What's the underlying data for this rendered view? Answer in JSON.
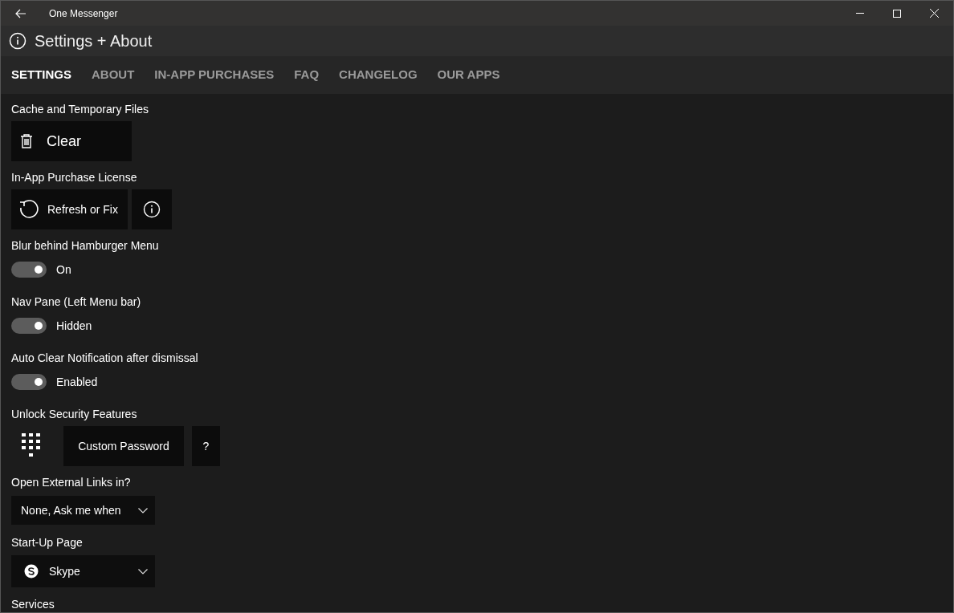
{
  "window": {
    "title": "One Messenger"
  },
  "page_title": "Settings + About",
  "tabs": [
    {
      "label": "SETTINGS",
      "selected": true
    },
    {
      "label": "ABOUT",
      "selected": false
    },
    {
      "label": "IN-APP PURCHASES",
      "selected": false
    },
    {
      "label": "FAQ",
      "selected": false
    },
    {
      "label": "CHANGELOG",
      "selected": false
    },
    {
      "label": "OUR APPS",
      "selected": false
    }
  ],
  "sections": [
    {
      "label": "Cache and Temporary Files",
      "kind": "buttons",
      "buttons": [
        {
          "kind": "trash",
          "label": "Clear"
        }
      ]
    },
    {
      "label": "In-App Purchase License",
      "kind": "buttons",
      "buttons": [
        {
          "kind": "refresh",
          "label": "Refresh or Fix"
        },
        {
          "kind": "info"
        }
      ]
    },
    {
      "label": "Blur behind Hamburger Menu",
      "kind": "toggle",
      "on": true,
      "state_text": "On"
    },
    {
      "label": "Nav Pane (Left Menu bar)",
      "kind": "toggle",
      "on": true,
      "state_text": "Hidden"
    },
    {
      "label": "Auto Clear Notification after dismissal",
      "kind": "toggle",
      "on": true,
      "state_text": "Enabled"
    },
    {
      "label": "Unlock Security Features",
      "kind": "buttons",
      "buttons": [
        {
          "kind": "keypad"
        },
        {
          "kind": "text",
          "label": "Custom Password"
        },
        {
          "kind": "text",
          "label": "?"
        }
      ]
    },
    {
      "label": "Open External Links in?",
      "kind": "dropdown",
      "value": "None, Ask me when"
    },
    {
      "label": "Start-Up Page",
      "kind": "app_dropdown",
      "value": "Skype"
    },
    {
      "label": "Services",
      "kind": "heading"
    }
  ]
}
